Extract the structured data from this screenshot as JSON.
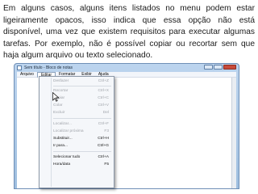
{
  "paragraph": "Em alguns casos, alguns itens listados no menu podem estar ligeiramente opacos, isso indica que essa opção não está disponível, uma vez que existem requisitos para executar algumas tarefas. Por exemplo, não é possível copiar ou recortar sem que haja algum arquivo ou texto selecionado.",
  "window": {
    "title": "Sem título - Bloco de notas",
    "menus": [
      "Arquivo",
      "Editar",
      "Formatar",
      "Exibir",
      "Ajuda"
    ],
    "active_menu": "Editar"
  },
  "edit_menu": [
    {
      "label": "Desfazer",
      "shortcut": "Ctrl+Z",
      "enabled": false
    },
    {
      "label": "Recortar",
      "shortcut": "Ctrl+X",
      "enabled": false
    },
    {
      "label": "Copiar",
      "shortcut": "Ctrl+C",
      "enabled": false
    },
    {
      "label": "Colar",
      "shortcut": "Ctrl+V",
      "enabled": false
    },
    {
      "label": "Excluir",
      "shortcut": "Del",
      "enabled": false
    },
    {
      "label": "Localizar...",
      "shortcut": "Ctrl+F",
      "enabled": false
    },
    {
      "label": "Localizar próxima",
      "shortcut": "F3",
      "enabled": false
    },
    {
      "label": "Substituir...",
      "shortcut": "Ctrl+H",
      "enabled": true
    },
    {
      "label": "Ir para...",
      "shortcut": "Ctrl+G",
      "enabled": true
    },
    {
      "label": "Selecionar tudo",
      "shortcut": "Ctrl+A",
      "enabled": true
    },
    {
      "label": "Hora/data",
      "shortcut": "F5",
      "enabled": true
    }
  ],
  "colors": {
    "enabled_text": "#111111",
    "disabled_text": "#a0a4aa"
  },
  "icons": [
    "notepad-icon",
    "minimize-icon",
    "maximize-icon",
    "close-icon",
    "mouse-pointer-icon"
  ]
}
